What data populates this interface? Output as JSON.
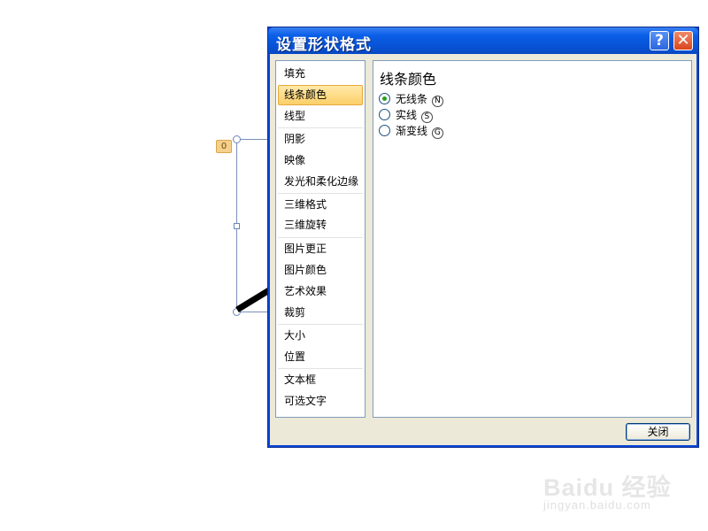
{
  "canvas": {
    "number_tag": "0"
  },
  "dialog": {
    "title": "设置形状格式",
    "help_label": "?",
    "close_label": "✕",
    "nav": {
      "items": [
        {
          "label": "填充",
          "selected": false
        },
        {
          "label": "线条颜色",
          "selected": true
        },
        {
          "label": "线型",
          "selected": false
        },
        {
          "label": "阴影",
          "selected": false
        },
        {
          "label": "映像",
          "selected": false
        },
        {
          "label": "发光和柔化边缘",
          "selected": false
        },
        {
          "label": "三维格式",
          "selected": false
        },
        {
          "label": "三维旋转",
          "selected": false
        },
        {
          "label": "图片更正",
          "selected": false
        },
        {
          "label": "图片颜色",
          "selected": false
        },
        {
          "label": "艺术效果",
          "selected": false
        },
        {
          "label": "裁剪",
          "selected": false
        },
        {
          "label": "大小",
          "selected": false
        },
        {
          "label": "位置",
          "selected": false
        },
        {
          "label": "文本框",
          "selected": false
        },
        {
          "label": "可选文字",
          "selected": false
        }
      ]
    },
    "content": {
      "title": "线条颜色",
      "options": [
        {
          "label": "无线条",
          "mnemonic": "N",
          "checked": true
        },
        {
          "label": "实线",
          "mnemonic": "S",
          "checked": false
        },
        {
          "label": "渐变线",
          "mnemonic": "G",
          "checked": false
        }
      ]
    },
    "footer": {
      "close_button": "关闭"
    }
  },
  "watermark": {
    "main": "Baidu 经验",
    "sub": "jingyan.baidu.com"
  }
}
